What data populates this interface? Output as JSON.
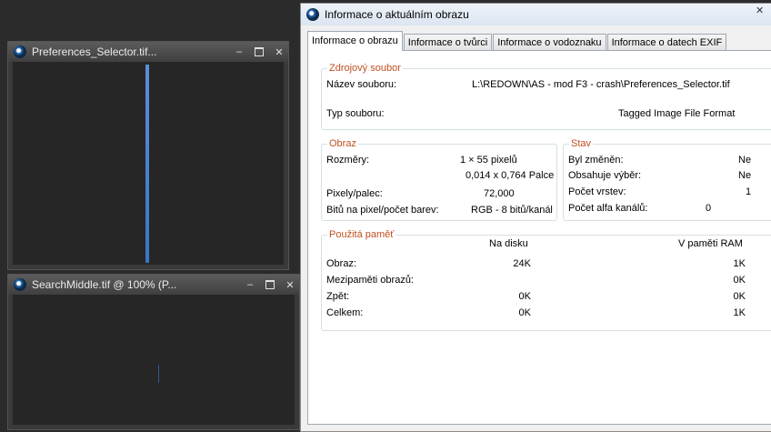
{
  "doc_windows": [
    {
      "title": "Preferences_Selector.tif...",
      "min": "–",
      "close": "✕"
    },
    {
      "title": "SearchMiddle.tif @ 100% (P...",
      "min": "–",
      "close": "✕"
    }
  ],
  "dialog": {
    "title": "Informace o aktuálním obrazu",
    "close": "✕",
    "tabs": [
      "Informace o obrazu",
      "Informace o tvůrci",
      "Informace o vodoznaku",
      "Informace o datech EXIF"
    ],
    "source": {
      "legend": "Zdrojový soubor",
      "name_label": "Název souboru:",
      "name_value": "L:\\REDOWN\\AS - mod F3 - crash\\Preferences_Selector.tif",
      "type_label": "Typ souboru:",
      "type_value": "Tagged Image File Format"
    },
    "image": {
      "legend": "Obraz",
      "dims_label": "Rozměry:",
      "dims_px": "1 × 55 pixelů",
      "dims_in": "0,014 x 0,764 Palce",
      "ppi_label": "Pixely/palec:",
      "ppi_value": "72,000",
      "bits_label": "Bitů na pixel/počet barev:",
      "bits_value": "RGB - 8 bitů/kanál"
    },
    "state": {
      "legend": "Stav",
      "changed_label": "Byl změněn:",
      "changed_value": "Ne",
      "selection_label": "Obsahuje výběr:",
      "selection_value": "Ne",
      "layers_label": "Počet vrstev:",
      "layers_value": "1",
      "alpha_label": "Počet alfa kanálů:",
      "alpha_value": "0"
    },
    "memory": {
      "legend": "Použitá paměť",
      "col_disk": "Na disku",
      "col_ram": "V paměti RAM",
      "rows": [
        {
          "label": "Obraz:",
          "disk": "24K",
          "ram": "1K"
        },
        {
          "label": "Mezipaměti obrazů:",
          "disk": "",
          "ram": "0K"
        },
        {
          "label": "Zpět:",
          "disk": "0K",
          "ram": "0K"
        },
        {
          "label": "Celkem:",
          "disk": "0K",
          "ram": "1K"
        }
      ]
    }
  }
}
